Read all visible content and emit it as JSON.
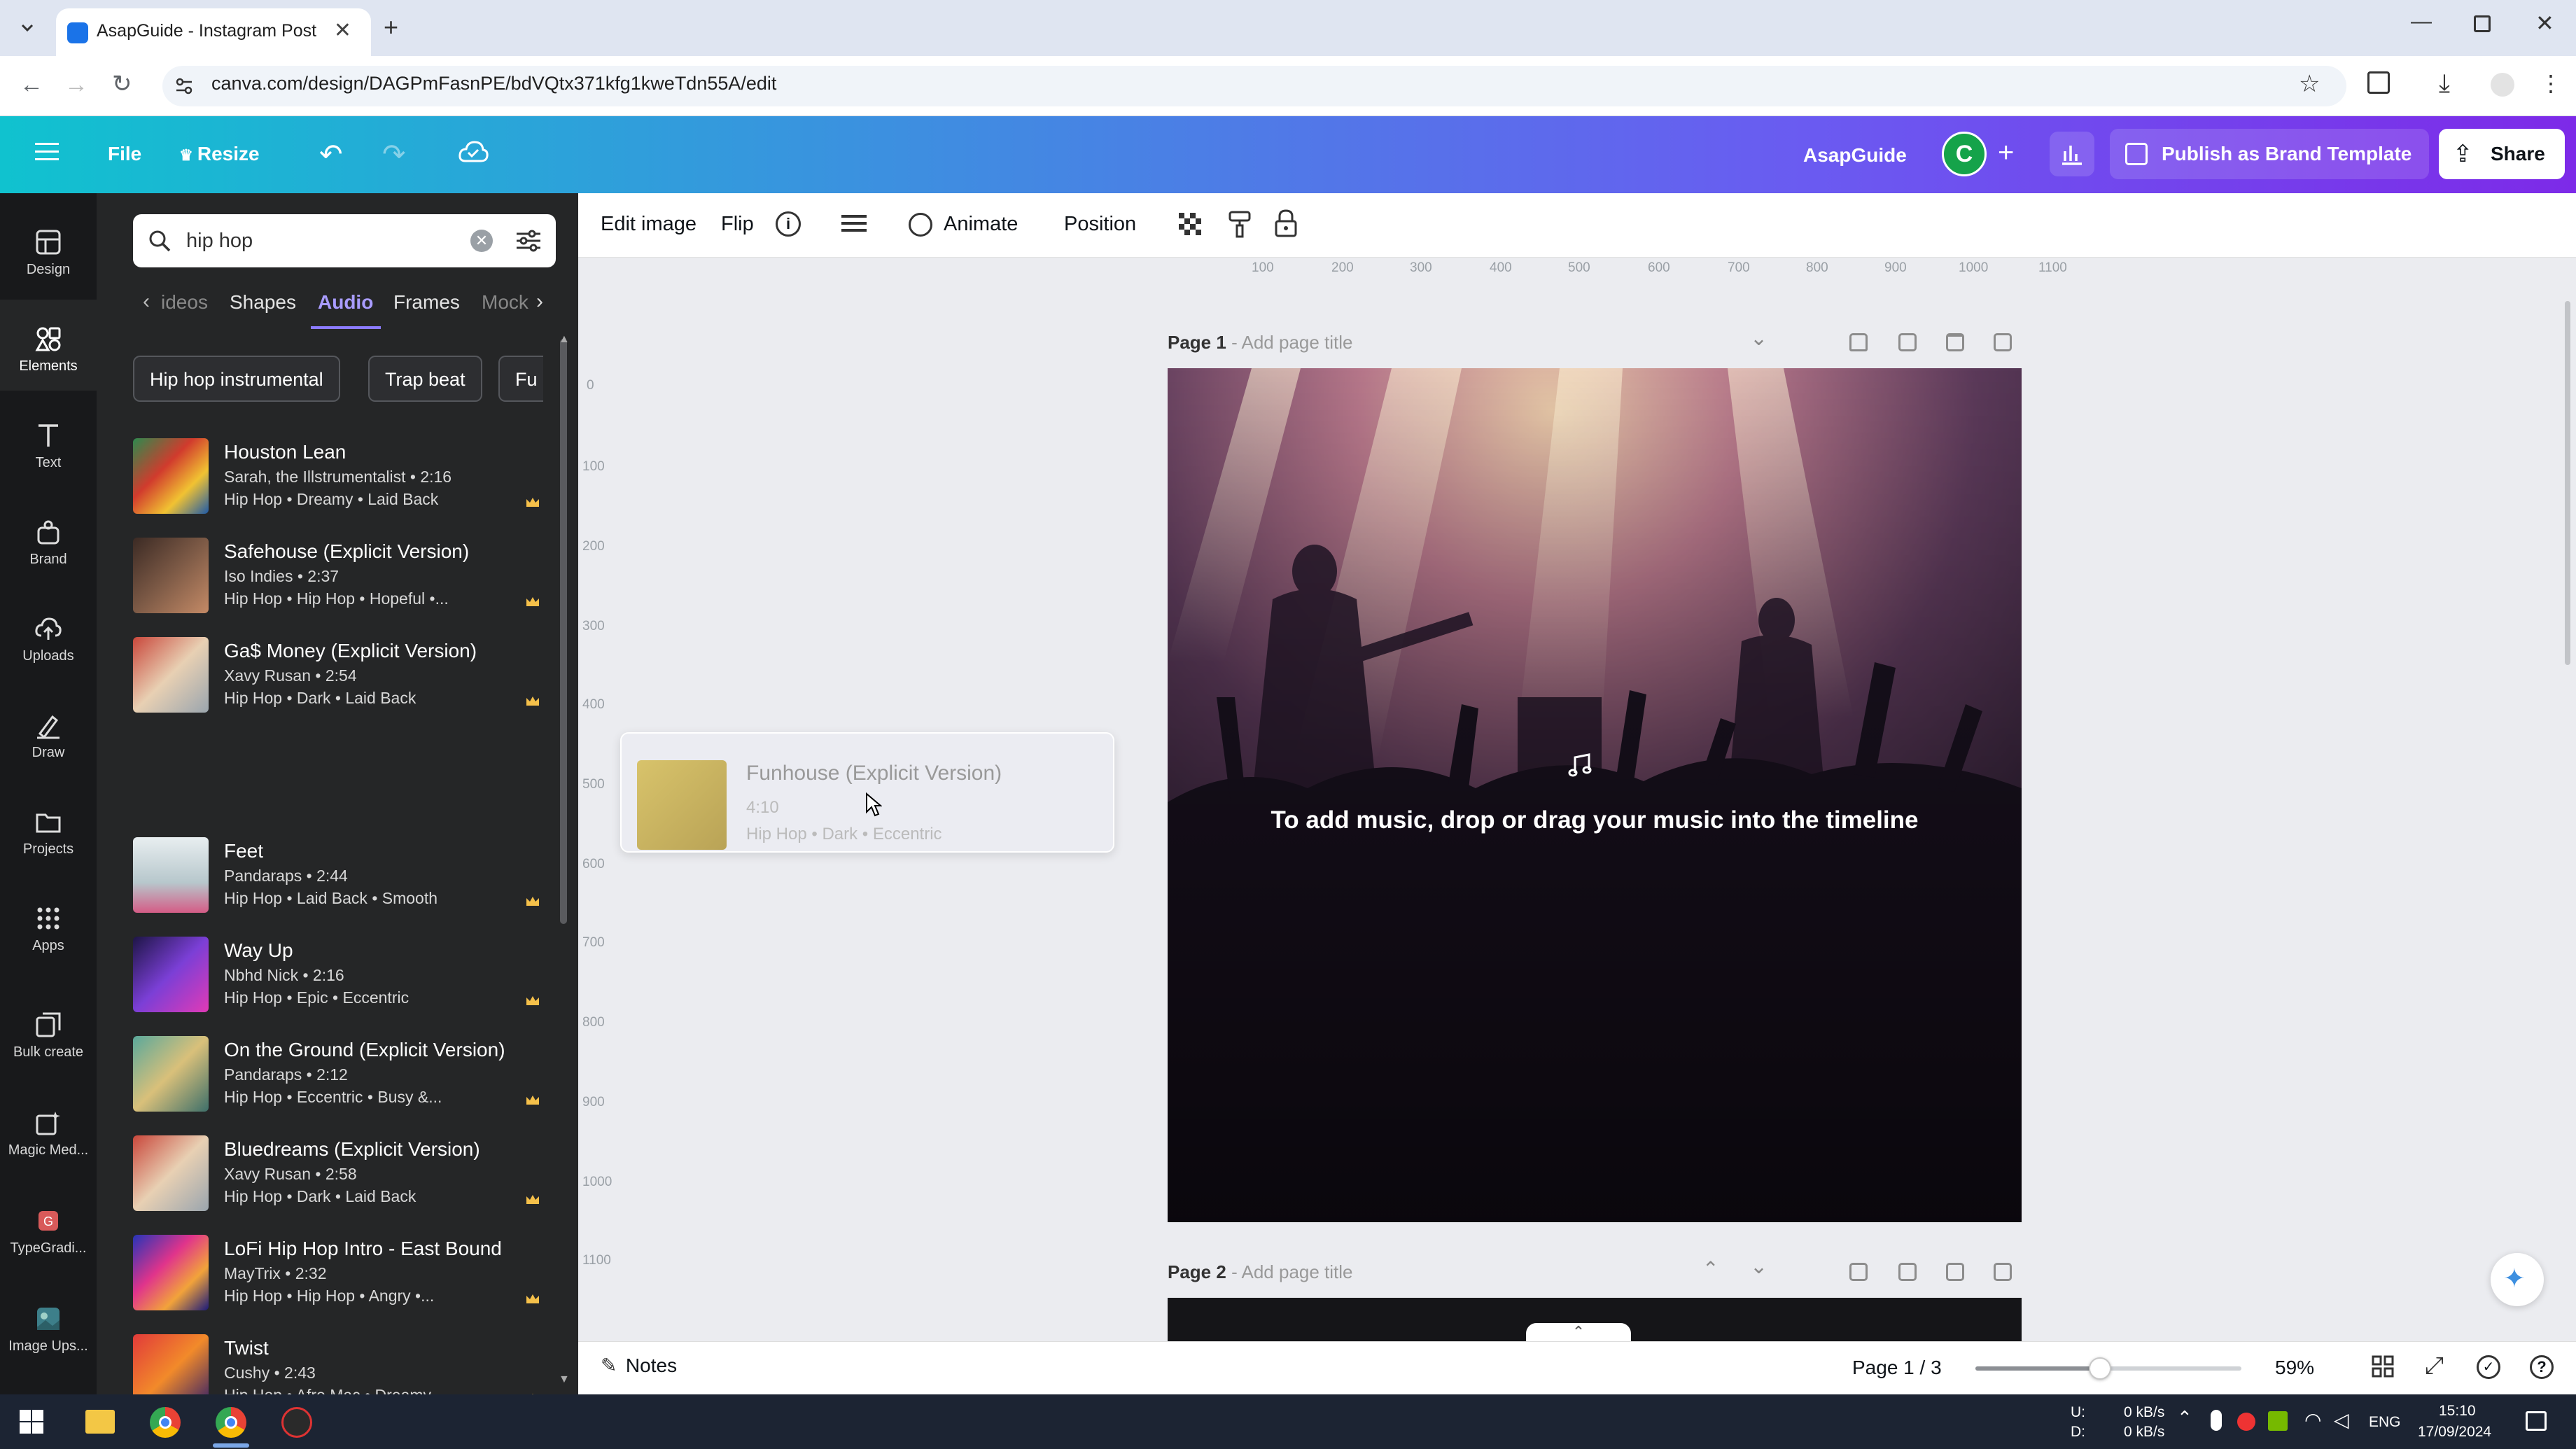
{
  "browser": {
    "tab_title": "AsapGuide - Instagram Post",
    "url": "canva.com/design/DAGPmFasnPE/bdVQtx371kfg1kweTdn55A/edit"
  },
  "header": {
    "file": "File",
    "resize": "Resize",
    "brand": "AsapGuide",
    "avatar_letter": "C",
    "publish": "Publish as Brand Template",
    "share": "Share"
  },
  "rail": {
    "items": [
      {
        "label": "Design",
        "icon": "design-icon"
      },
      {
        "label": "Elements",
        "icon": "elements-icon"
      },
      {
        "label": "Text",
        "icon": "text-icon"
      },
      {
        "label": "Brand",
        "icon": "brand-icon"
      },
      {
        "label": "Uploads",
        "icon": "uploads-icon"
      },
      {
        "label": "Draw",
        "icon": "draw-icon"
      },
      {
        "label": "Projects",
        "icon": "projects-icon"
      },
      {
        "label": "Apps",
        "icon": "apps-icon"
      },
      {
        "label": "Bulk create",
        "icon": "bulk-create-icon"
      },
      {
        "label": "Magic Med...",
        "icon": "magic-media-icon"
      },
      {
        "label": "TypeGradi...",
        "icon": "typegradient-icon"
      },
      {
        "label": "Image Ups...",
        "icon": "image-upscaler-icon"
      }
    ]
  },
  "panel": {
    "search_value": "hip hop",
    "tabs": [
      "ideos",
      "Shapes",
      "Audio",
      "Frames",
      "Mock"
    ],
    "active_tab": "Audio",
    "chips": [
      "Hip hop instrumental",
      "Trap beat",
      "Fu"
    ],
    "tracks": [
      {
        "title": "Houston Lean",
        "meta": "Sarah, the Illstrumentalist • 2:16",
        "tags": "Hip Hop • Dreamy • Laid Back"
      },
      {
        "title": "Safehouse (Explicit Version)",
        "meta": "Iso Indies • 2:37",
        "tags": "Hip Hop • Hip Hop • Hopeful •..."
      },
      {
        "title": "Ga$ Money (Explicit Version)",
        "meta": "Xavy Rusan • 2:54",
        "tags": "Hip Hop • Dark • Laid Back"
      },
      {
        "title": "Feet",
        "meta": "Pandaraps • 2:44",
        "tags": "Hip Hop • Laid Back • Smooth"
      },
      {
        "title": "Way Up",
        "meta": "Nbhd Nick • 2:16",
        "tags": "Hip Hop • Epic • Eccentric"
      },
      {
        "title": "On the Ground (Explicit Version)",
        "meta": "Pandaraps • 2:12",
        "tags": "Hip Hop • Eccentric • Busy &..."
      },
      {
        "title": "Bluedreams (Explicit Version)",
        "meta": "Xavy Rusan • 2:58",
        "tags": "Hip Hop • Dark • Laid Back"
      },
      {
        "title": "LoFi Hip Hop Intro - East Bound",
        "meta": "MayTrix • 2:32",
        "tags": "Hip Hop • Hip Hop • Angry •..."
      },
      {
        "title": "Twist",
        "meta": "Cushy • 2:43",
        "tags": "Hip Hop • Afro Mac • Dreamy"
      }
    ],
    "dragging": {
      "title": "Funhouse (Explicit Version)",
      "meta": "4:10",
      "tags": "Hip Hop • Dark • Eccentric"
    }
  },
  "toolbar": {
    "edit_image": "Edit image",
    "flip": "Flip",
    "animate": "Animate",
    "position": "Position"
  },
  "ruler": [
    "100",
    "200",
    "300",
    "400",
    "500",
    "600",
    "700",
    "800",
    "900",
    "1000",
    "1100"
  ],
  "vruler": [
    "0",
    "100",
    "200",
    "300",
    "400",
    "500",
    "600",
    "700",
    "800",
    "900",
    "1000",
    "1100"
  ],
  "pages": {
    "page1_label": "Page 1",
    "page1_title": "- Add page title",
    "page2_label": "Page 2",
    "page2_title": "- Add page title",
    "drop_hint": "To add music, drop or drag your music into the timeline"
  },
  "bottom": {
    "notes": "Notes",
    "page_indicator": "Page 1 / 3",
    "zoom": "59%",
    "zoom_fraction": 0.59
  },
  "taskbar": {
    "net_up_label": "U:",
    "net_down_label": "D:",
    "net_up": "0 kB/s",
    "net_down": "0 kB/s",
    "lang": "ENG",
    "time": "15:10",
    "date": "17/09/2024"
  },
  "colors": {
    "canva_gradient_start": "#10c2cf",
    "canva_gradient_end": "#7d2ae8",
    "panel_bg": "#252627",
    "rail_bg": "#18191b",
    "avatar": "#15a34a"
  }
}
